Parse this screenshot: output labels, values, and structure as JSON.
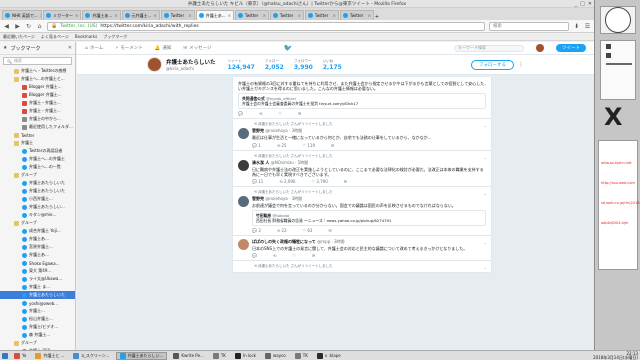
{
  "window": {
    "title": "弁護士あたらしいた キビル（東京）（@hatsu_adachiさん）| Twitterから@東京ツイート - Mozilla Firefox"
  },
  "tabs": [
    {
      "label": "NHK 英語で...",
      "active": false
    },
    {
      "label": "ミガ一ター",
      "active": false
    },
    {
      "label": "弁護士あ...",
      "active": false
    },
    {
      "label": "元弁護士...",
      "active": false
    },
    {
      "label": "Twitter",
      "active": false
    },
    {
      "label": "弁護士あ...",
      "active": true
    },
    {
      "label": "Twitter",
      "active": false
    },
    {
      "label": "Twitter",
      "active": false
    },
    {
      "label": "Twitter",
      "active": false
    },
    {
      "label": "Twitter",
      "active": false
    }
  ],
  "navbar": {
    "url_site": "Twitter, Inc. (US)",
    "url": "https://twitter.com/kiria_adachi/with_replies",
    "search_placeholder": "検索"
  },
  "bookmarks_bar": [
    "最近開いたページ",
    "よく見るページ",
    "Bookmarks",
    "ブックマーク"
  ],
  "sidebar": {
    "title": "ブックマーク",
    "search_placeholder": "検索",
    "items": [
      {
        "label": "弁護士へ・Twitterの感想",
        "icon": "folder-icon",
        "selected": false
      },
      {
        "label": "弁護士へ...の弁護士と...",
        "icon": "folder-icon",
        "selected": false
      },
      {
        "label": "Blogger 弁護士...",
        "icon": "red-icon",
        "selected": false
      },
      {
        "label": "Blogger 弁護士...",
        "icon": "red-icon",
        "selected": false
      },
      {
        "label": "弁護士・弁護士...",
        "icon": "red-icon",
        "selected": false
      },
      {
        "label": "弁護士・弁護士...",
        "icon": "red-icon",
        "selected": false
      },
      {
        "label": "弁護士の中から...",
        "icon": "gray-icon",
        "selected": false
      },
      {
        "label": "最近使用したフォルダ...",
        "icon": "gray-icon",
        "selected": false
      },
      {
        "label": "Twitter",
        "icon": "folder-icon",
        "selected": false
      },
      {
        "label": "弁護士",
        "icon": "folder-icon",
        "selected": false
      },
      {
        "label": "Twitterの再認証者",
        "icon": "blue-icon",
        "selected": false
      },
      {
        "label": "弁護士へ...の弁護士",
        "icon": "blue-icon",
        "selected": false
      },
      {
        "label": "弁護士へ...の一覧",
        "icon": "blue-icon",
        "selected": false
      },
      {
        "label": "グループ",
        "icon": "folder-icon",
        "selected": false
      },
      {
        "label": "弁護士あたらしいた",
        "icon": "blue-icon",
        "selected": false
      },
      {
        "label": "弁護士あたらしいた",
        "icon": "blue-icon",
        "selected": false
      },
      {
        "label": "小西弁護士...",
        "icon": "blue-icon",
        "selected": false
      },
      {
        "label": "弁護士あたらしい...",
        "icon": "blue-icon",
        "selected": false
      },
      {
        "label": "キタン@mie...",
        "icon": "blue-icon",
        "selected": false
      },
      {
        "label": "グループ",
        "icon": "folder-icon",
        "selected": false
      },
      {
        "label": "成合弁護士 Yoji...",
        "icon": "blue-icon",
        "selected": false
      },
      {
        "label": "弁護士あ...",
        "icon": "blue-icon",
        "selected": false
      },
      {
        "label": "宮原弁護士...",
        "icon": "blue-icon",
        "selected": false
      },
      {
        "label": "弁護士あ...",
        "icon": "blue-icon",
        "selected": false
      },
      {
        "label": "Shoko Egawa...",
        "icon": "blue-icon",
        "selected": false
      },
      {
        "label": "東大 第49... ",
        "icon": "blue-icon",
        "selected": false
      },
      {
        "label": "ライ太@Ukawa...",
        "icon": "blue-icon",
        "selected": false
      },
      {
        "label": "弁護士 ま...",
        "icon": "blue-icon",
        "selected": false
      },
      {
        "label": "弁護士あたらしいた",
        "icon": "blue-icon",
        "selected": true
      },
      {
        "label": "yoshi@oweb...",
        "icon": "blue-icon",
        "selected": false
      },
      {
        "label": "弁護士...",
        "icon": "blue-icon",
        "selected": false
      },
      {
        "label": "松山弁護士...",
        "icon": "blue-icon",
        "selected": false
      },
      {
        "label": "弁護士/ビデオ...",
        "icon": "blue-icon",
        "selected": false
      },
      {
        "label": "森 弁護士...",
        "icon": "blue-icon",
        "selected": false
      },
      {
        "label": "グループ",
        "icon": "folder-icon",
        "selected": false
      },
      {
        "label": "弁護士 戸田...",
        "icon": "blue-icon",
        "selected": false
      },
      {
        "label": "CLEC(E)...",
        "icon": "blue-icon",
        "selected": false
      }
    ]
  },
  "twitter_nav": {
    "home": "ホーム",
    "moments": "モーメント",
    "notifications": "通知",
    "messages": "メッセージ",
    "search_placeholder": "キーワード検索",
    "tweet_button": "ツイート"
  },
  "profile": {
    "name": "弁護士あたらしいた",
    "handle": "@kiria_adachi",
    "stats": [
      {
        "label": "ツイート",
        "value": "124,947"
      },
      {
        "label": "フォロー",
        "value": "2,052"
      },
      {
        "label": "フォロワー",
        "value": "3,990"
      },
      {
        "label": "いいね",
        "value": "2,175"
      }
    ],
    "follow_button": "フォローする"
  },
  "tweets": [
    {
      "context": "",
      "name": "",
      "handle": "",
      "time": "",
      "text": "弁護士の有資格の3回に対する重ねてを持ちに利用させ、また弁護士会から指定させるかやは下がるかも言葉としての役割として安心したい弁護士ガキボンスを得るのに思いました。こんなの弁護士情報は必要ない。",
      "quote": {
        "name": "共同通信公式",
        "handle": "@kyodo_official",
        "text": "弁護士会の弁護士会審査委員の弁護士を批判 tinyurl.com/y83ck17"
      },
      "replies": "",
      "retweets": "",
      "likes": ""
    },
    {
      "context": "弁護士あたらしいた さんがリツイートしました",
      "name": "菅野完",
      "handle": "@noiehoya",
      "time": "3時間",
      "text": "最近は仕事が生活と一緒になっているから何とか、自宅でも法務の仕事をしているから、なかなか...",
      "quote": null,
      "replies": "1",
      "retweets": "25",
      "likes": "119"
    },
    {
      "context": "弁護士あたらしいた さんがリツイートしました",
      "name": "清水潔 人",
      "handle": "@NOsimizu",
      "time": "5時間",
      "text": "日に難病や弁護士法の改正を実施しようとしているのに、ここまで必要な法律化の検討が必要だ。法改正は本来の職業を支持する為に一日でも早く実現すべきでございます。",
      "quote": null,
      "replies": "11",
      "retweets": "2,090",
      "likes": "3,790"
    },
    {
      "context": "弁護士あたらしいた さんがリツイートしました",
      "name": "菅野完",
      "handle": "@noiehoya",
      "time": "3時間",
      "text": "お前達が議会で何を言っているのか分からない。国会での議論は国民の声を反映させるものでなければならない。",
      "quote": {
        "name": "竹田聡彦",
        "handle": "@tokoda",
        "text": "西田社長 財務省職員の告発 ～ニュース｜news.yahoo.co.jp/pickup/6274791"
      },
      "replies": "3",
      "retweets": "23",
      "likes": "63"
    },
    {
      "context": "",
      "name": "ぱぱのしの失く政権の犠牲になって",
      "handle": "@mpp",
      "time": "3時間",
      "text": "日本のSNS上での弁護士の発言に関して、弁護士会の対応と民主的な議論について改めて考えるきっかけとなりました。",
      "quote": null,
      "replies": "",
      "retweets": "",
      "likes": ""
    },
    {
      "context": "弁護士あたらしいた さんがリツイートしました",
      "name": "",
      "handle": "",
      "time": "",
      "text": "",
      "quote": null,
      "replies": "",
      "retweets": "",
      "likes": ""
    }
  ],
  "right_panel": {
    "clock_label": "X",
    "red_lines": [
      "whw.sa-hjahn.net",
      "http://xxx.web.com",
      "sd-web.co.jp(Hn)2018年",
      "adplid/20l4-hjm"
    ]
  },
  "taskbar": {
    "tasks": [
      {
        "label": "Yo",
        "active": false
      },
      {
        "label": "弁護士と ...",
        "active": false
      },
      {
        "label": "a_スクリーン...",
        "active": false
      },
      {
        "label": "弁護士あたらしい...",
        "active": true
      },
      {
        "label": "Kwrite Pe...",
        "active": false
      },
      {
        "label": "TK",
        "active": false
      },
      {
        "label": "In lock",
        "active": false
      },
      {
        "label": "wayco",
        "active": false
      },
      {
        "label": "TK",
        "active": false
      },
      {
        "label": "x :klape",
        "active": false
      }
    ],
    "time": "22:13",
    "date": "2018年3月14日(水曜日)"
  }
}
